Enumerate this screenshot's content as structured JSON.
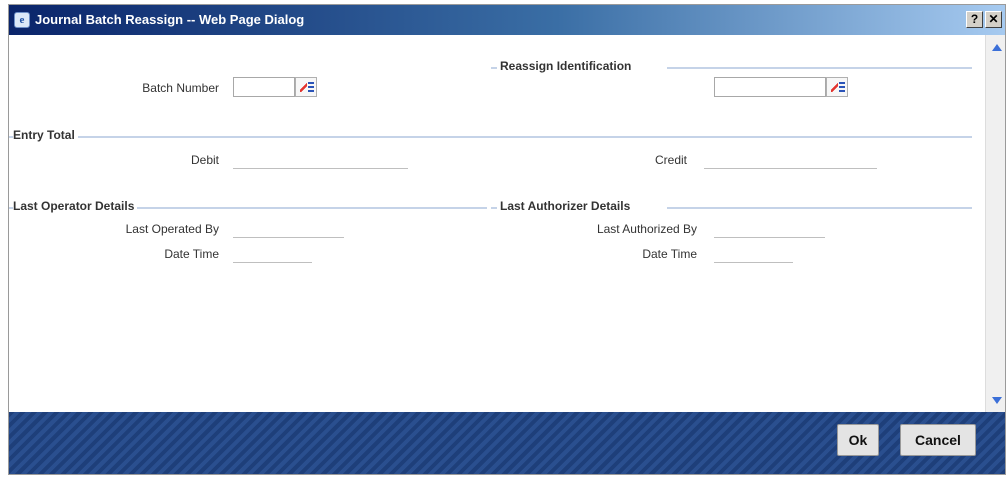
{
  "window": {
    "title": "Journal Batch Reassign -- Web Page Dialog",
    "help_button": "?",
    "close_button": "✕"
  },
  "batch": {
    "label": "Batch Number",
    "value": ""
  },
  "reassign": {
    "section_title": "Reassign Identification",
    "value": ""
  },
  "entry_total": {
    "section_title": "Entry Total",
    "debit_label": "Debit",
    "debit_value": "",
    "credit_label": "Credit",
    "credit_value": ""
  },
  "last_operator": {
    "section_title": "Last Operator Details",
    "operated_by_label": "Last Operated By",
    "operated_by_value": "",
    "date_time_label": "Date Time",
    "date_time_value": ""
  },
  "last_authorizer": {
    "section_title": "Last Authorizer Details",
    "authorized_by_label": "Last Authorized By",
    "authorized_by_value": "",
    "date_time_label": "Date Time",
    "date_time_value": ""
  },
  "footer": {
    "ok_label": "Ok",
    "cancel_label": "Cancel"
  },
  "icons": {
    "title_icon": "ie-page-icon",
    "lov": "list-of-values-icon"
  },
  "colors": {
    "titlebar_start": "#0a246a",
    "titlebar_end": "#a6caf0",
    "footer": "#1e3f7a",
    "section_line": "#c5d3e8"
  }
}
